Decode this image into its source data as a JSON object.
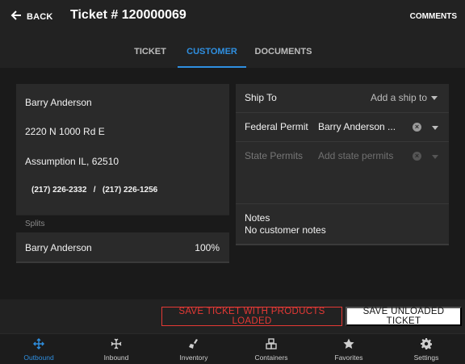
{
  "header": {
    "back_label": "BACK",
    "title": "Ticket # 120000069",
    "comments_label": "COMMENTS"
  },
  "tabs": [
    {
      "label": "TICKET",
      "active": false
    },
    {
      "label": "CUSTOMER",
      "active": true
    },
    {
      "label": "DOCUMENTS",
      "active": false
    }
  ],
  "customer": {
    "name": "Barry Anderson",
    "street": "2220 N 1000 Rd E",
    "city_state_zip": "Assumption IL, 62510",
    "phone1": "(217) 226-2332",
    "separator": "/",
    "phone2": "(217) 226-1256"
  },
  "splits": {
    "header": "Splits",
    "rows": [
      {
        "name": "Barry Anderson",
        "percent": "100%"
      }
    ]
  },
  "ship_to": {
    "label": "Ship To",
    "placeholder": "Add a ship to"
  },
  "federal_permit": {
    "label": "Federal Permit",
    "value": "Barry Anderson ..."
  },
  "state_permits": {
    "label": "State Permits",
    "placeholder": "Add state permits"
  },
  "notes": {
    "label": "Notes",
    "value": "No customer notes"
  },
  "actions": {
    "save_loaded": "SAVE TICKET WITH PRODUCTS LOADED",
    "save_unloaded": "SAVE UNLOADED TICKET"
  },
  "bottom_nav": [
    {
      "label": "Outbound",
      "icon": "outbound-arrows-icon",
      "active": true
    },
    {
      "label": "Inbound",
      "icon": "inbound-arrows-icon",
      "active": false
    },
    {
      "label": "Inventory",
      "icon": "inventory-broom-icon",
      "active": false
    },
    {
      "label": "Containers",
      "icon": "containers-icon",
      "active": false
    },
    {
      "label": "Favorites",
      "icon": "star-icon",
      "active": false
    },
    {
      "label": "Settings",
      "icon": "gear-icon",
      "active": false
    }
  ],
  "colors": {
    "accent": "#2f8fe0",
    "danger": "#e53935",
    "header_bg": "#222222",
    "card_bg": "#2a2a2a"
  }
}
